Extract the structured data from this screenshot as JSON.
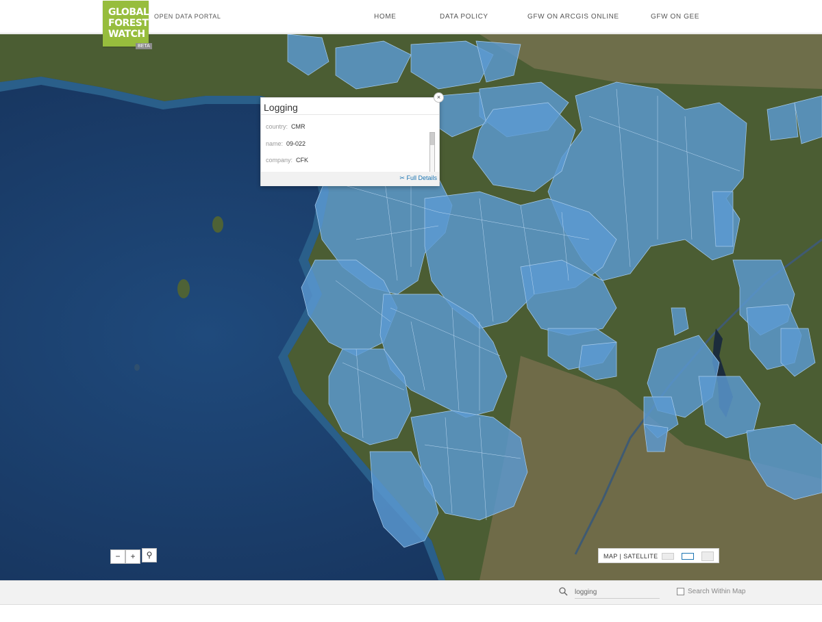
{
  "header": {
    "logo_lines": [
      "GLOBAL",
      "FOREST",
      "WATCH"
    ],
    "beta": "BETA",
    "portal_label": "OPEN DATA PORTAL",
    "nav": [
      "HOME",
      "DATA POLICY",
      "GFW ON ARCGIS ONLINE",
      "GFW ON GEE"
    ]
  },
  "popup": {
    "title": "Logging",
    "fields": [
      {
        "key": "country:",
        "value": "CMR"
      },
      {
        "key": "name:",
        "value": "09-022"
      },
      {
        "key": "company:",
        "value": "CFK"
      }
    ],
    "full_details": "Full Details",
    "close": "×"
  },
  "map_controls": {
    "zoom_out": "−",
    "zoom_in": "+",
    "search_glyph": "⚲",
    "basemap_label": "MAP | SATELLITE"
  },
  "footer": {
    "search_value": "logging",
    "within_map_label": "Search Within Map"
  },
  "colors": {
    "brand": "#97bd3d",
    "concession_fill": "#5b9ad2",
    "ocean": "#1c3c68",
    "land": "#47582f"
  },
  "icons": {
    "search": "magnifier-icon",
    "full_details": "scissors-icon"
  }
}
